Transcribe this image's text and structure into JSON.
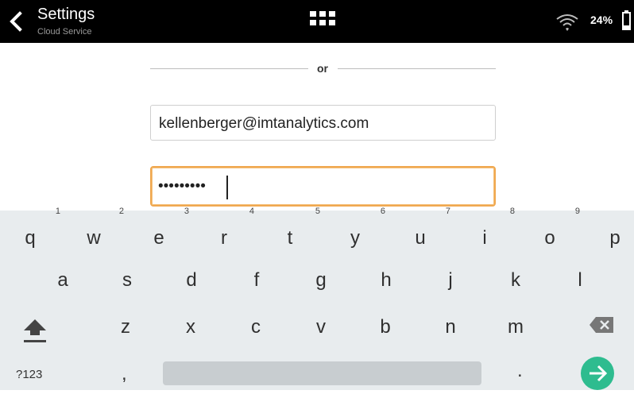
{
  "header": {
    "title": "Settings",
    "subtitle": "Cloud Service",
    "battery_percent": "24%"
  },
  "form": {
    "divider_text": "or",
    "email_value": "kellenberger@imtanalytics.com",
    "password_mask": "•••••••••"
  },
  "keyboard": {
    "row1": [
      {
        "key": "q",
        "hint": "1"
      },
      {
        "key": "w",
        "hint": "2"
      },
      {
        "key": "e",
        "hint": "3"
      },
      {
        "key": "r",
        "hint": "4"
      },
      {
        "key": "t",
        "hint": "5"
      },
      {
        "key": "y",
        "hint": "6"
      },
      {
        "key": "u",
        "hint": "7"
      },
      {
        "key": "i",
        "hint": "8"
      },
      {
        "key": "o",
        "hint": "9"
      },
      {
        "key": "p",
        "hint": ""
      }
    ],
    "row2": [
      "a",
      "s",
      "d",
      "f",
      "g",
      "h",
      "j",
      "k",
      "l"
    ],
    "row3": [
      "z",
      "x",
      "c",
      "v",
      "b",
      "n",
      "m"
    ],
    "symbols_label": "?123",
    "comma_label": ",",
    "period_label": "."
  },
  "colors": {
    "accent": "#2ebc8f",
    "focus_border": "#f0a84f",
    "top_bar": "#000000"
  },
  "icons": {
    "back": "chevron-left-icon",
    "apps": "grid-icon",
    "wifi": "wifi-icon",
    "battery": "battery-icon",
    "shift": "shift-arrow-icon",
    "backspace": "backspace-icon",
    "go": "arrow-right-icon"
  }
}
